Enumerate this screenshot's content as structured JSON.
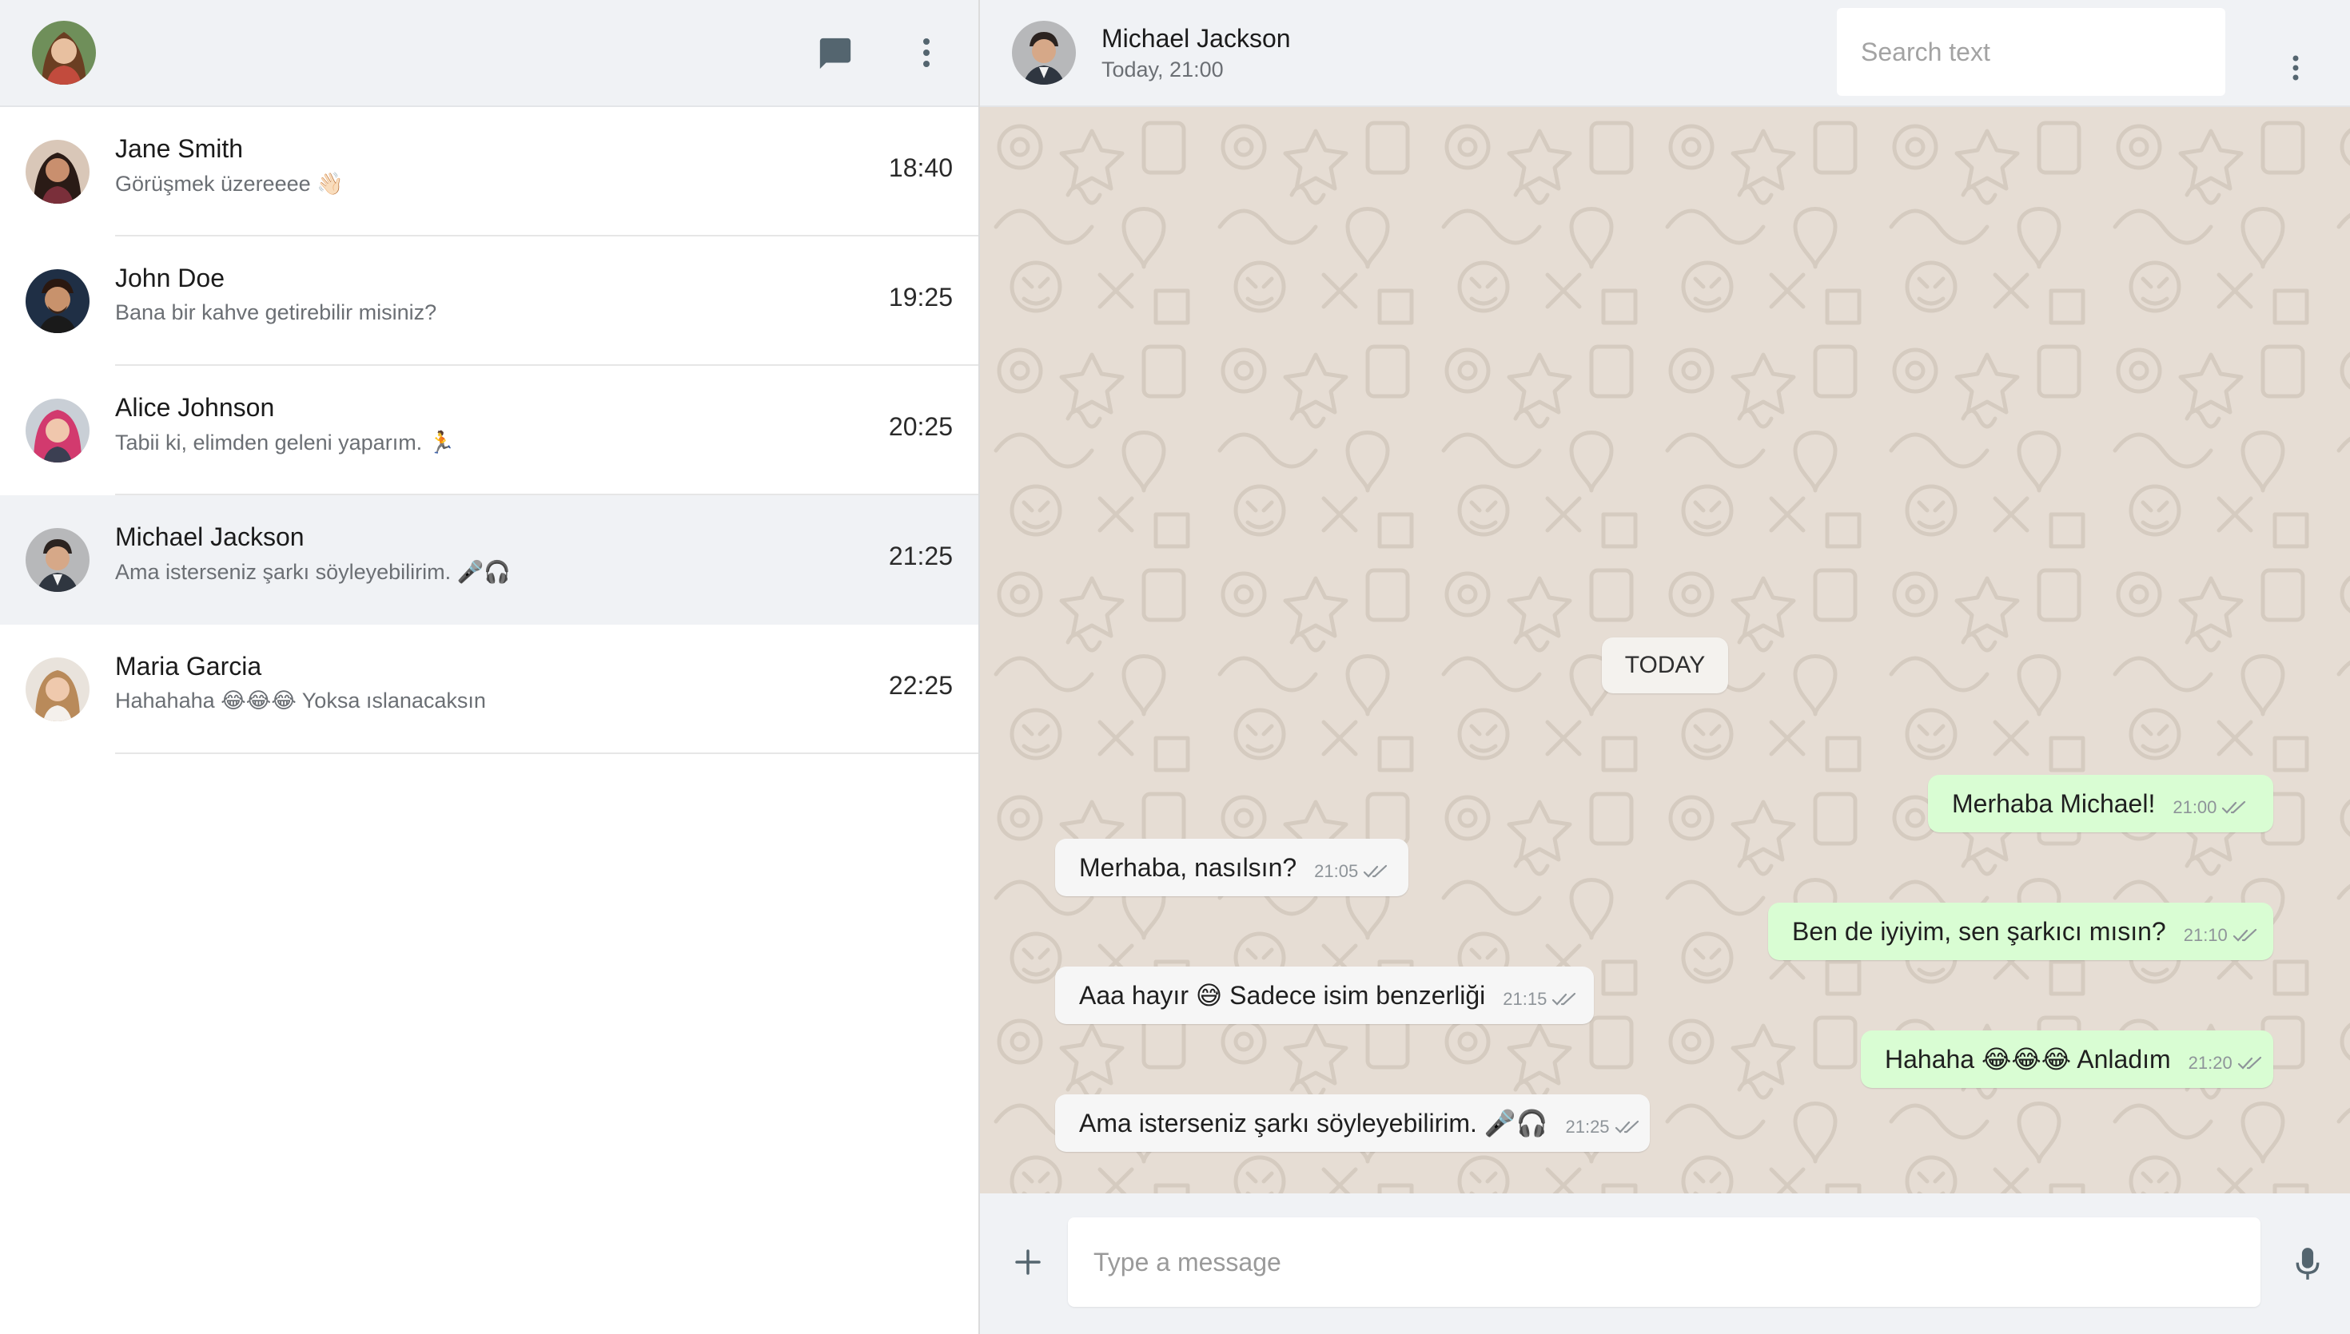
{
  "colors": {
    "header_bg": "#f0f2f5",
    "chat_bg": "#e6ddd4",
    "incoming_bubble": "#f6f6f6",
    "outgoing_bubble": "#d9fdd3",
    "active_chat_bg": "#f0f2f5",
    "icon_gray": "#54656f"
  },
  "sidebar": {
    "icons": [
      "avatar",
      "chat-icon",
      "more-vertical-icon"
    ],
    "chats": [
      {
        "name": "Jane Smith",
        "preview": "Görüşmek üzereeee 👋🏻",
        "time": "18:40"
      },
      {
        "name": "John Doe",
        "preview": "Bana bir kahve getirebilir misiniz?",
        "time": "19:25"
      },
      {
        "name": "Alice Johnson",
        "preview": "Tabii ki, elimden geleni yaparım. 🏃",
        "time": "20:25"
      },
      {
        "name": "Michael Jackson",
        "preview": "Ama isterseniz şarkı söyleyebilirim. 🎤🎧",
        "time": "21:25"
      },
      {
        "name": "Maria Garcia",
        "preview": "Hahahaha 😂😂😂 Yoksa ıslanacaksın",
        "time": "22:25"
      }
    ]
  },
  "chat": {
    "contact_name": "Michael Jackson",
    "contact_status": "Today, 21:00",
    "search_placeholder": "Search text",
    "date_divider": "TODAY",
    "messages": [
      {
        "direction": "out",
        "text": "Merhaba Michael!",
        "time": "21:00"
      },
      {
        "direction": "in",
        "text": "Merhaba, nasılsın?",
        "time": "21:05"
      },
      {
        "direction": "out",
        "text": "Ben de iyiyim, sen şarkıcı mısın?",
        "time": "21:10"
      },
      {
        "direction": "in",
        "text": "Aaa hayır 😅 Sadece isim benzerliği",
        "time": "21:15"
      },
      {
        "direction": "out",
        "text": "Hahaha 😂😂😂 Anladım",
        "time": "21:20"
      },
      {
        "direction": "in",
        "text": "Ama isterseniz şarkı söyleyebilirim. 🎤🎧",
        "time": "21:25"
      }
    ]
  },
  "composer": {
    "placeholder": "Type a message",
    "icons": [
      "plus-icon",
      "microphone-icon"
    ]
  }
}
